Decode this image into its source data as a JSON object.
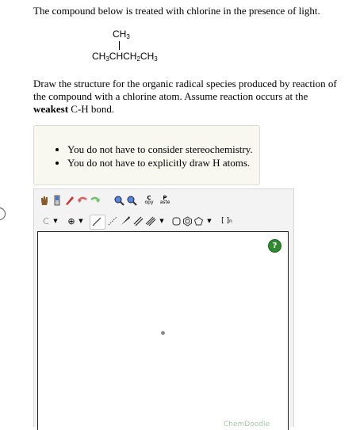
{
  "question": {
    "intro": "The compound below is treated with chlorine in the presence of light.",
    "structure": {
      "top_group": "CH",
      "top_sub": "3",
      "chain_parts": [
        {
          "t": "CH",
          "s": "3"
        },
        {
          "t": "CHCH",
          "s": "2"
        },
        {
          "t": "CH",
          "s": "3"
        }
      ]
    },
    "prompt_part1": "Draw the structure for the organic radical species produced by reaction of the compound with a chlorine atom. Assume reaction occurs at the",
    "prompt_bold": "weakest",
    "prompt_part2": "C-H bond."
  },
  "notes": [
    "You do not have to consider stereochemistry.",
    "You do not have to explicitly draw H atoms."
  ],
  "sketcher": {
    "copy_label": "C",
    "copy_sub": "opy",
    "paste_label": "P",
    "paste_sub": "aste",
    "atom_label": "C",
    "charge_symbol": "⊕",
    "bracket_label": "[ ]",
    "bracket_sup": "n",
    "help_label": "?",
    "brand": "ChemDoodle"
  }
}
